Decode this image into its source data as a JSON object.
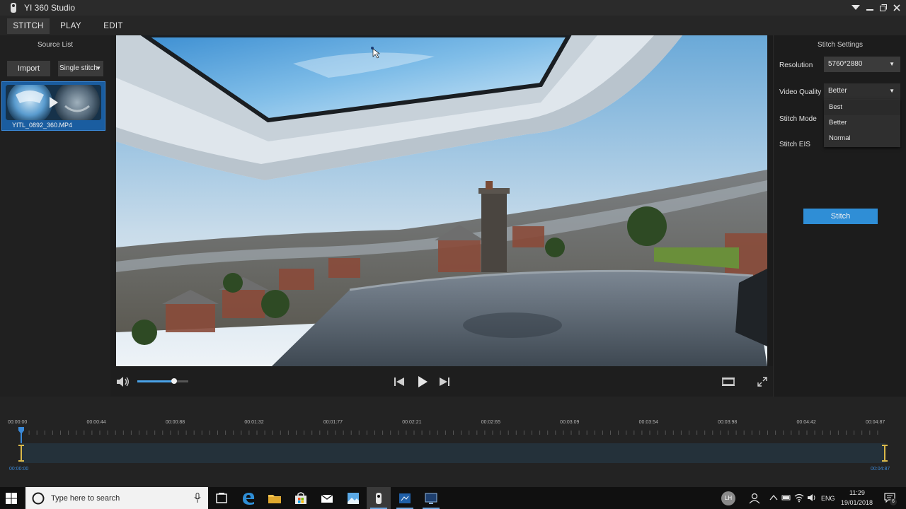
{
  "window": {
    "title": "YI 360 Studio"
  },
  "icons": {
    "app": "camera-icon",
    "menu": "dropdown-menu-icon",
    "minimize": "minimize-icon",
    "restore": "restore-icon",
    "close": "close-icon",
    "volume": "volume-icon",
    "prev": "skip-previous-icon",
    "play": "play-icon",
    "next": "skip-next-icon",
    "aspect": "aspect-ratio-icon",
    "fullscreen": "fullscreen-icon",
    "start": "windows-start-icon",
    "mic": "microphone-icon",
    "task_view": "task-view-icon",
    "edge": "edge-icon",
    "explorer": "folder-icon",
    "store": "store-icon",
    "mail": "mail-icon",
    "photos": "photos-icon",
    "yi": "yi-camera-icon",
    "app2": "video-app-icon",
    "app3": "screen-app-icon",
    "notifications": "notifications-icon",
    "marker_start": "in-point-marker-icon",
    "marker_end": "out-point-marker-icon",
    "playhead": "playhead-icon"
  },
  "tabs": [
    {
      "label": "STITCH",
      "active": true
    },
    {
      "label": "PLAY",
      "active": false
    },
    {
      "label": "EDIT",
      "active": false
    }
  ],
  "source_list": {
    "header": "Source List",
    "import_label": "Import",
    "mode_label": "Single stitch",
    "file_name": "YITL_0892_360.MP4"
  },
  "player": {
    "volume_level": 0.72
  },
  "stitch_settings": {
    "header": "Stitch Settings",
    "resolution_label": "Resolution",
    "resolution_value": "5760*2880",
    "video_quality_label": "Video Quality",
    "video_quality_value": "Better",
    "quality_options": [
      "Best",
      "Better",
      "Normal"
    ],
    "stitch_mode_label": "Stitch Mode",
    "stitch_eis_label": "Stitch EIS",
    "stitch_button": "Stitch"
  },
  "timeline": {
    "ticks": [
      "00:00:00",
      "00:00:44",
      "00:00:88",
      "00:01:32",
      "00:01:77",
      "00:02:21",
      "00:02:65",
      "00:03:09",
      "00:03:54",
      "00:03:98",
      "00:04:42",
      "00:04:87"
    ],
    "start_time": "00:00:00",
    "end_time": "00:04:87"
  },
  "taskbar": {
    "search_placeholder": "Type here to search",
    "language": "ENG",
    "time": "11:29",
    "date": "19/01/2018",
    "avatar_initials": "LH",
    "notification_count": "6"
  },
  "colors": {
    "accent": "#2f8ed6",
    "selection": "#1a5da0",
    "marker": "#d9b84a"
  }
}
